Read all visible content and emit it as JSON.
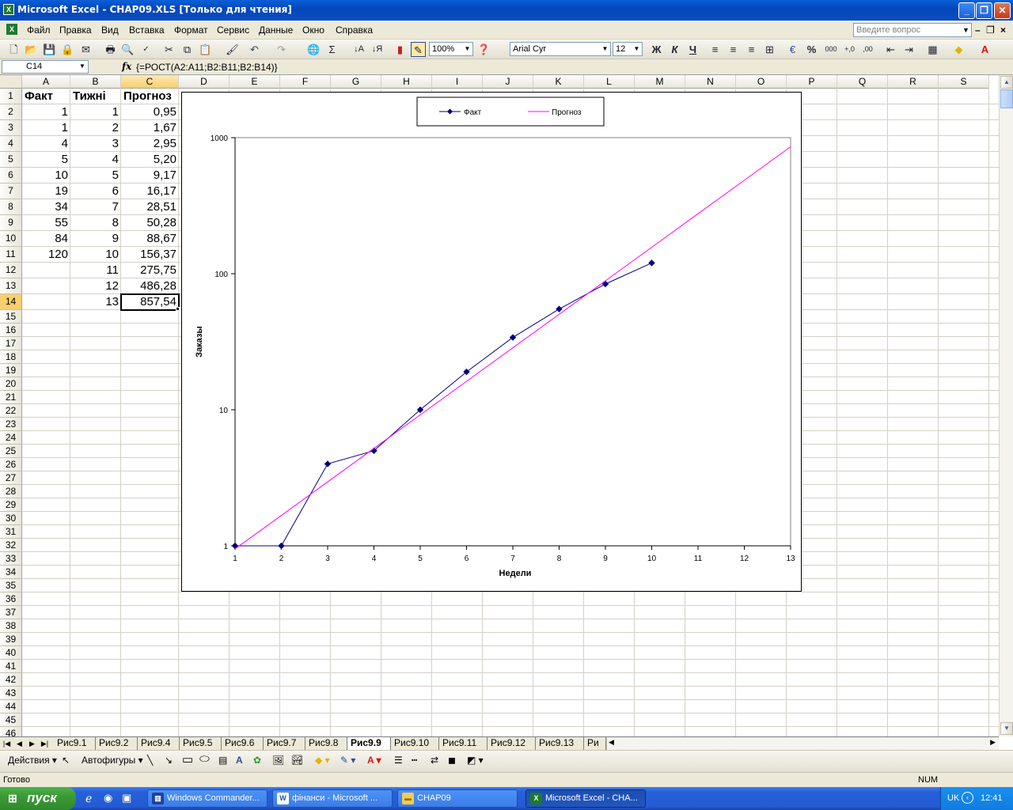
{
  "window": {
    "title": "Microsoft Excel - CHAP09.XLS  [Только для чтения]",
    "min": "_",
    "max": "❐",
    "close": "✕"
  },
  "menu": {
    "items": [
      "Файл",
      "Правка",
      "Вид",
      "Вставка",
      "Формат",
      "Сервис",
      "Данные",
      "Окно",
      "Справка"
    ],
    "ask_placeholder": "Введите вопрос"
  },
  "toolbar": {
    "zoom": "100%",
    "font": "Arial Cyr",
    "size": "12",
    "bold": "Ж",
    "italic": "К",
    "underline": "Ч",
    "sum": "Σ",
    "percent": "%",
    "thousands": "000"
  },
  "formula_bar": {
    "cell_ref": "C14",
    "fx": "fx",
    "formula": "{=РОСТ(A2:A11;B2:B11;B2:B14)}"
  },
  "columns": [
    "A",
    "B",
    "C",
    "D",
    "E",
    "F",
    "G",
    "H",
    "I",
    "J",
    "K",
    "L",
    "M",
    "N",
    "O",
    "P",
    "Q",
    "R",
    "S"
  ],
  "rows": [
    "1",
    "2",
    "3",
    "4",
    "5",
    "6",
    "7",
    "8",
    "9",
    "10",
    "11",
    "12",
    "13",
    "14",
    "15",
    "16",
    "17",
    "18",
    "19",
    "20",
    "21",
    "22",
    "23",
    "24",
    "25",
    "26",
    "27",
    "28",
    "29",
    "30",
    "31",
    "32",
    "33",
    "34",
    "35",
    "36",
    "37",
    "38",
    "39",
    "40",
    "41",
    "42",
    "43",
    "44",
    "45",
    "46"
  ],
  "cells": {
    "headers": [
      "Факт",
      "Тижні",
      "Прогноз"
    ],
    "fact": [
      "1",
      "1",
      "4",
      "5",
      "10",
      "19",
      "34",
      "55",
      "84",
      "120",
      "",
      "",
      ""
    ],
    "weeks": [
      "1",
      "2",
      "3",
      "4",
      "5",
      "6",
      "7",
      "8",
      "9",
      "10",
      "11",
      "12",
      "13"
    ],
    "forecast": [
      "0,95",
      "1,67",
      "2,95",
      "5,20",
      "9,17",
      "16,17",
      "28,51",
      "50,28",
      "88,67",
      "156,37",
      "275,75",
      "486,28",
      "857,54"
    ]
  },
  "chart_data": {
    "type": "line",
    "x": [
      1,
      2,
      3,
      4,
      5,
      6,
      7,
      8,
      9,
      10,
      11,
      12,
      13
    ],
    "x_ticks": [
      "1",
      "2",
      "3",
      "4",
      "5",
      "6",
      "7",
      "8",
      "9",
      "10",
      "11",
      "12",
      "13"
    ],
    "y_ticks": [
      "1",
      "10",
      "100",
      "1000"
    ],
    "yscale": "log",
    "ylim": [
      1,
      1000
    ],
    "xlim": [
      1,
      13
    ],
    "xlabel": "Недели",
    "ylabel": "Заказы",
    "legend_position": "top",
    "series": [
      {
        "name": "Факт",
        "color": "#000080",
        "marker": "diamond",
        "values": [
          1,
          1,
          4,
          5,
          10,
          19,
          34,
          55,
          84,
          120
        ]
      },
      {
        "name": "Прогноз",
        "color": "#ff00ff",
        "marker": "none",
        "values": [
          0.95,
          1.67,
          2.95,
          5.2,
          9.17,
          16.17,
          28.51,
          50.28,
          88.67,
          156.37,
          275.75,
          486.28,
          857.54
        ]
      }
    ]
  },
  "sheet_tabs": [
    "Рис9.1",
    "Рис9.2",
    "Рис9.4",
    "Рис9.5",
    "Рис9.6",
    "Рис9.7",
    "Рис9.8",
    "Рис9.9",
    "Рис9.10",
    "Рис9.11",
    "Рис9.12",
    "Рис9.13",
    "Ри"
  ],
  "active_tab": "Рис9.9",
  "drawing": {
    "actions": "Действия",
    "autoshapes": "Автофигуры"
  },
  "status": {
    "ready": "Готово",
    "num": "NUM"
  },
  "taskbar": {
    "start": "пуск",
    "tasks": [
      "Windows Commander...",
      "фінанси - Microsoft ...",
      "CHAP09",
      "Microsoft Excel - CHA..."
    ],
    "lang": "UK",
    "clock": "12:41"
  }
}
